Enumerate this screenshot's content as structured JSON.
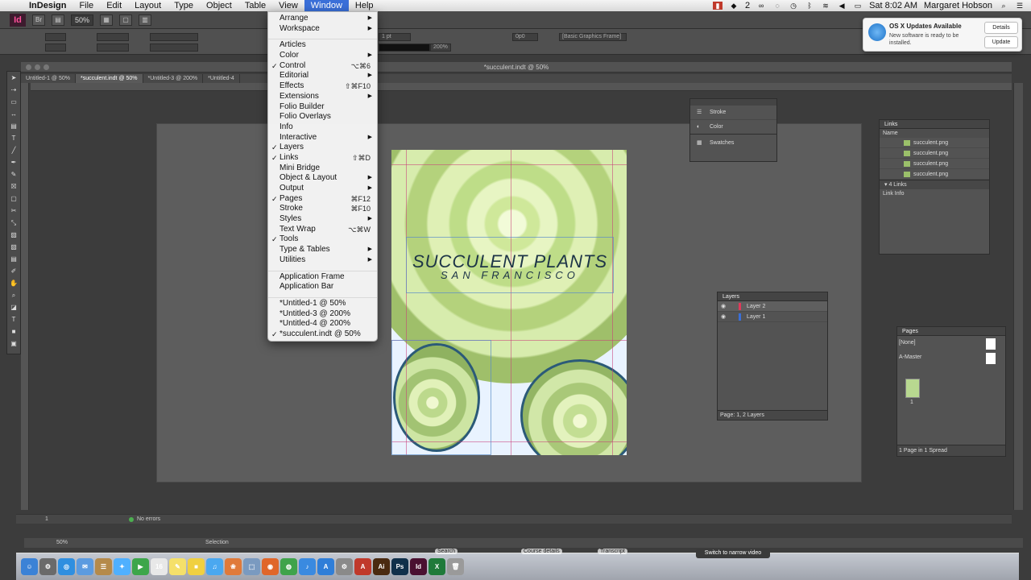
{
  "menubar": {
    "app_name": "InDesign",
    "items": [
      "File",
      "Edit",
      "Layout",
      "Type",
      "Object",
      "Table",
      "View",
      "Window",
      "Help"
    ],
    "clock": "Sat 8:02 AM",
    "user": "Margaret Hobson",
    "badge_count": "2"
  },
  "appbar": {
    "logo": "Id",
    "bridge": "Br",
    "zoom": "50%"
  },
  "controlpanel": {
    "stroke_weight": "1 pt",
    "zoom_field": "100%",
    "zoom_field2": "200%",
    "pt_field": "0p0",
    "frame_style": "[Basic Graphics Frame]"
  },
  "window_title": "*succulent.indt @ 50%",
  "doc_tabs": [
    "Untitled-1 @ 50%",
    "*succulent.indt @ 50%",
    "*Untitled-3 @ 200%",
    "*Untitled-4"
  ],
  "window_menu": {
    "groups": [
      [
        {
          "label": "Arrange",
          "arrow": true
        },
        {
          "label": "Workspace",
          "arrow": true
        }
      ],
      [
        {
          "label": "Articles"
        },
        {
          "label": "Color",
          "arrow": true
        },
        {
          "label": "Control",
          "check": true,
          "shortcut": "⌥⌘6"
        },
        {
          "label": "Editorial",
          "arrow": true
        },
        {
          "label": "Effects",
          "shortcut": "⇧⌘F10"
        },
        {
          "label": "Extensions",
          "arrow": true
        },
        {
          "label": "Folio Builder"
        },
        {
          "label": "Folio Overlays"
        },
        {
          "label": "Info"
        },
        {
          "label": "Interactive",
          "arrow": true
        },
        {
          "label": "Layers",
          "check": true
        },
        {
          "label": "Links",
          "check": true,
          "shortcut": "⇧⌘D"
        },
        {
          "label": "Mini Bridge"
        },
        {
          "label": "Object & Layout",
          "arrow": true
        },
        {
          "label": "Output",
          "arrow": true
        },
        {
          "label": "Pages",
          "check": true,
          "shortcut": "⌘F12"
        },
        {
          "label": "Stroke",
          "shortcut": "⌘F10"
        },
        {
          "label": "Styles",
          "arrow": true
        },
        {
          "label": "Text Wrap",
          "shortcut": "⌥⌘W"
        },
        {
          "label": "Tools",
          "check": true
        },
        {
          "label": "Type & Tables",
          "arrow": true
        },
        {
          "label": "Utilities",
          "arrow": true
        }
      ],
      [
        {
          "label": "Application Frame"
        },
        {
          "label": "Application Bar"
        }
      ],
      [
        {
          "label": "*Untitled-1 @ 50%"
        },
        {
          "label": "*Untitled-3 @ 200%"
        },
        {
          "label": "*Untitled-4 @ 200%"
        },
        {
          "label": "*succulent.indt @ 50%",
          "check": true
        }
      ]
    ]
  },
  "document": {
    "title": "SUCCULENT PLANTS",
    "subtitle": "SAN FRANCISCO"
  },
  "notification": {
    "title": "OS X Updates Available",
    "body": "New software is ready to be installed.",
    "btn_details": "Details",
    "btn_update": "Update"
  },
  "stroke_panel": {
    "items": [
      "Stroke",
      "Color",
      "Swatches"
    ]
  },
  "links_panel": {
    "title": "Links",
    "column": "Name",
    "files": [
      "succulent.png",
      "succulent.png",
      "succulent.png",
      "succulent.png"
    ],
    "count": "4 Links",
    "info": "Link Info"
  },
  "layers_panel": {
    "title": "Layers",
    "layers": [
      "Layer 2",
      "Layer 1"
    ],
    "footer": "Page: 1, 2 Layers"
  },
  "pages_panel": {
    "title": "Pages",
    "none": "[None]",
    "master": "A-Master",
    "page_num": "1",
    "footer": "1 Page in 1 Spread"
  },
  "statusbar": {
    "page": "1",
    "errors": "No errors"
  },
  "bottombar": {
    "zoom": "50%",
    "tool": "Selection"
  },
  "dock": {
    "tooltip": "Switch to narrow video",
    "labels": [
      "Search",
      "Course details",
      "Transcript"
    ],
    "icons": [
      {
        "name": "finder-icon",
        "glyph": "☺",
        "color": "#3b82d6"
      },
      {
        "name": "launchpad-icon",
        "glyph": "⚙",
        "color": "#6a6a6a"
      },
      {
        "name": "safari-icon",
        "glyph": "◎",
        "color": "#2f8fe0"
      },
      {
        "name": "mail-icon",
        "glyph": "✉",
        "color": "#5b9be0"
      },
      {
        "name": "contacts-icon",
        "glyph": "☰",
        "color": "#b58a4a"
      },
      {
        "name": "messages-icon",
        "glyph": "✦",
        "color": "#4fb0ff"
      },
      {
        "name": "facetime-icon",
        "glyph": "▶",
        "color": "#3da64a"
      },
      {
        "name": "calendar-icon",
        "glyph": "16",
        "color": "#e8e8e8"
      },
      {
        "name": "notes-icon",
        "glyph": "✎",
        "color": "#f5e06a"
      },
      {
        "name": "stickies-icon",
        "glyph": "■",
        "color": "#f0d040"
      },
      {
        "name": "itunes-icon",
        "glyph": "♫",
        "color": "#4aa8f0"
      },
      {
        "name": "photos-icon",
        "glyph": "❀",
        "color": "#e07a3a"
      },
      {
        "name": "preview-icon",
        "glyph": "⬚",
        "color": "#7a9ac0"
      },
      {
        "name": "firefox-icon",
        "glyph": "◉",
        "color": "#e0662a"
      },
      {
        "name": "chrome-icon",
        "glyph": "◍",
        "color": "#3fa34a"
      },
      {
        "name": "itunes-store-icon",
        "glyph": "♪",
        "color": "#3a8ae0"
      },
      {
        "name": "app-store-icon",
        "glyph": "A",
        "color": "#2f7ed8"
      },
      {
        "name": "system-prefs-icon",
        "glyph": "⚙",
        "color": "#8a8a8a"
      },
      {
        "name": "acrobat-icon",
        "glyph": "A",
        "color": "#c0392b"
      },
      {
        "name": "illustrator-icon",
        "glyph": "Ai",
        "color": "#4a2a10"
      },
      {
        "name": "photoshop-icon",
        "glyph": "Ps",
        "color": "#10304a"
      },
      {
        "name": "indesign-icon",
        "glyph": "Id",
        "color": "#4a1030"
      },
      {
        "name": "excel-icon",
        "glyph": "X",
        "color": "#1f7a3a"
      },
      {
        "name": "trash-icon",
        "glyph": "🗑",
        "color": "#9a9a9a"
      }
    ]
  },
  "colors": {
    "menu_highlight": "#3a6fd8",
    "title_color": "#1d3447",
    "indesign_pink": "#ff4f9a"
  }
}
